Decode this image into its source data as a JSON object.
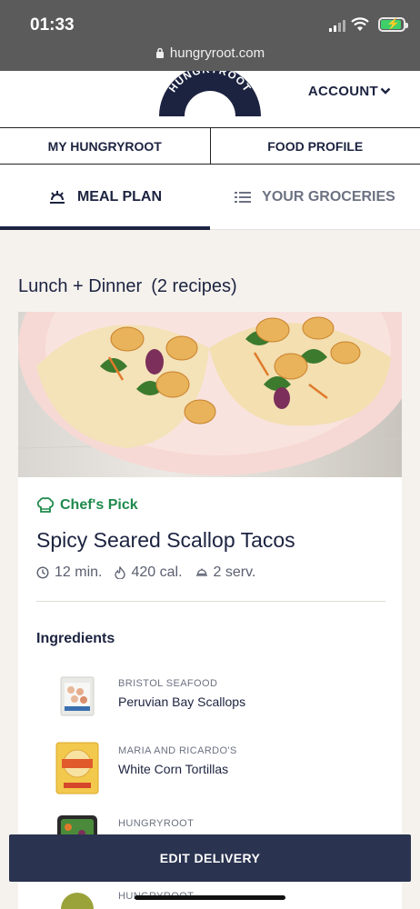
{
  "status_bar": {
    "time": "01:33",
    "url": "hungryroot.com"
  },
  "header": {
    "logo_text": "HUNGRYROOT",
    "account_label": "ACCOUNT"
  },
  "sub_tabs": [
    {
      "label": "MY HUNGRYROOT"
    },
    {
      "label": "FOOD PROFILE"
    }
  ],
  "main_tabs": [
    {
      "label": "MEAL PLAN",
      "active": true
    },
    {
      "label": "YOUR GROCERIES",
      "active": false
    }
  ],
  "section": {
    "title": "Lunch + Dinner",
    "count": "(2 recipes)"
  },
  "recipe": {
    "badge": "Chef's Pick",
    "name": "Spicy Seared Scallop Tacos",
    "time": "12 min.",
    "calories": "420 cal.",
    "servings": "2 serv.",
    "ingredients_title": "Ingredients",
    "ingredients": [
      {
        "brand": "BRISTOL SEAFOOD",
        "name": "Peruvian Bay Scallops"
      },
      {
        "brand": "MARIA AND RICARDO'S",
        "name": "White Corn Tortillas"
      },
      {
        "brand": "HUNGRYROOT",
        "name": ""
      },
      {
        "brand": "HUNGRYROOT",
        "name": ""
      }
    ]
  },
  "footer": {
    "edit_delivery_label": "EDIT DELIVERY"
  },
  "colors": {
    "navy": "#1c2340",
    "button": "#2a3350",
    "chef_green": "#1f8a4c",
    "background": "#f5f2ee"
  }
}
